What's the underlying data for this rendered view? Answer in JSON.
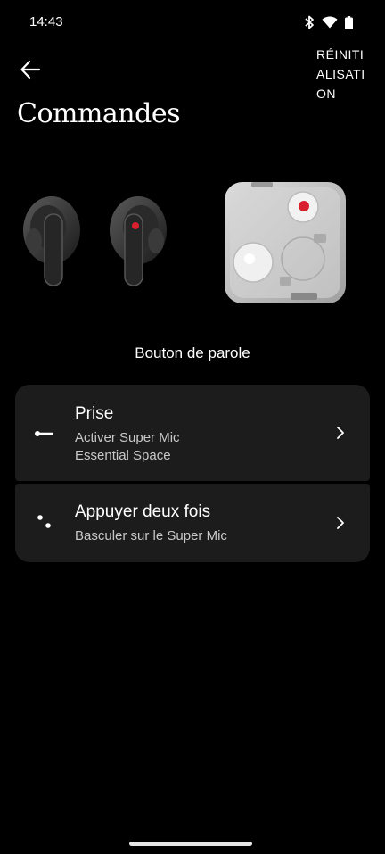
{
  "status_bar": {
    "time": "14:43",
    "icons": [
      "bluetooth-icon",
      "wifi-icon",
      "battery-icon"
    ]
  },
  "header": {
    "back_icon": "arrow-left-icon",
    "reset_label": "RÉINITIALISATION",
    "title": "Commandes"
  },
  "hero": {
    "left_image": "earbuds-image",
    "right_image": "charging-case-image"
  },
  "section": {
    "label": "Bouton de parole"
  },
  "options": [
    {
      "title": "Prise",
      "lines": [
        "Activer Super Mic",
        "Essential Space"
      ],
      "icon": "hold-gesture-icon"
    },
    {
      "title": "Appuyer deux fois",
      "lines": [
        "Basculer sur le Super Mic"
      ],
      "icon": "double-tap-icon"
    }
  ],
  "colors": {
    "background": "#000000",
    "card": "#1c1c1c",
    "accent_red": "#d9202e"
  }
}
